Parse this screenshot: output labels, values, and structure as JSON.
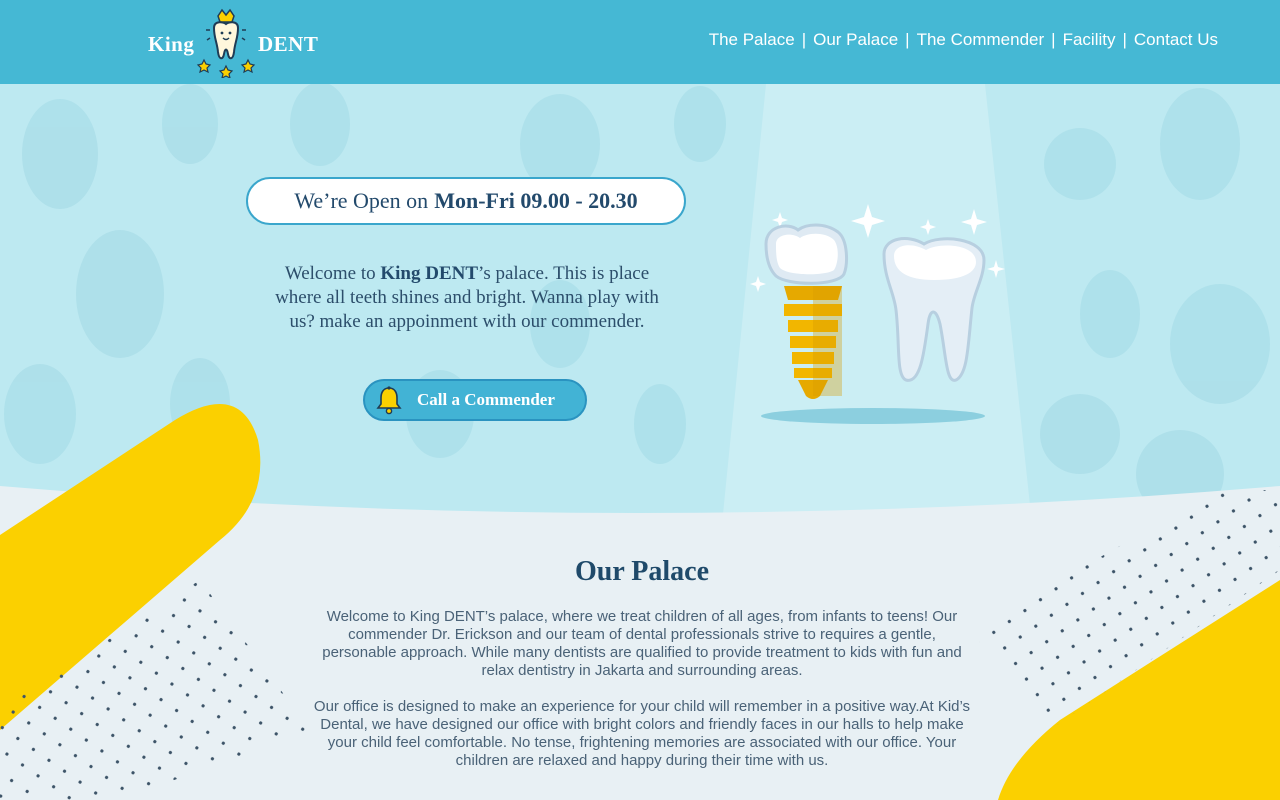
{
  "brand": {
    "left": "King",
    "right": "DENT"
  },
  "nav": {
    "items": [
      "The Palace",
      "Our Palace",
      "The Commender",
      "Facility",
      "Contact Us"
    ],
    "separator": "|"
  },
  "hero": {
    "hours_prefix": "We’re Open on",
    "hours_value": "Mon-Fri 09.00 - 20.30",
    "welcome_prefix": "Welcome to",
    "welcome_brand": "King DENT",
    "welcome_rest": "’s palace. This is place where all teeth shines and bright. Wanna play with us? make an appoinment with our commender.",
    "cta_label": "Call a Commender"
  },
  "section": {
    "title": "Our Palace",
    "paragraphs": [
      "Welcome to King DENT’s palace, where we treat children of all ages, from infants to teens! Our commender Dr. Erickson and our team of dental professionals strive to requires a gentle, personable approach. While many dentists are qualified to provide treatment to kids with fun and relax dentistry in Jakarta and surrounding areas.",
      "Our office is designed to make an experience for your child will remember in a positive way.At Kid’s Dental, we have designed our office with bright colors and friendly faces in our halls to help make your child feel comfortable. No tense, frightening memories are associated with our office. Your children are relaxed and happy during their time with us."
    ]
  },
  "colors": {
    "header": "#45b8d4",
    "hero_bg": "#bde9f1",
    "accent_yellow": "#fbd000",
    "heading": "#1f4a6a",
    "cta": "#42b3d5"
  },
  "icons": [
    "crown-tooth-logo-icon",
    "bell-icon",
    "dental-implant-icon",
    "tooth-icon"
  ]
}
